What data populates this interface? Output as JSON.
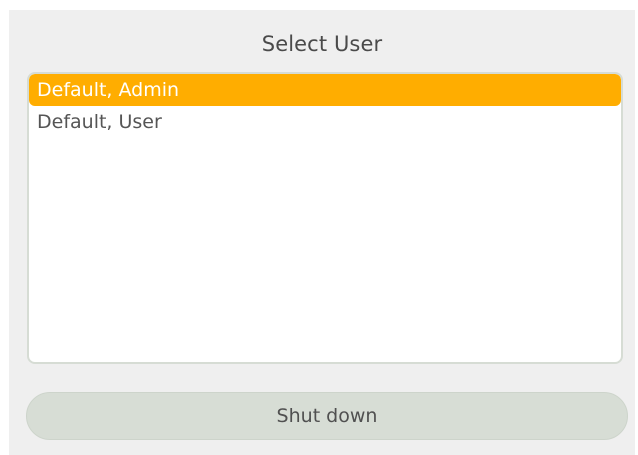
{
  "dialog": {
    "title": "Select User"
  },
  "user_list": {
    "items": [
      {
        "label": "Default, Admin",
        "selected": true
      },
      {
        "label": "Default, User",
        "selected": false
      }
    ]
  },
  "actions": {
    "shutdown_label": "Shut down"
  },
  "colors": {
    "selection": "#ffad00",
    "dialog_background": "#efefef",
    "button_background": "#d7ddd5"
  }
}
